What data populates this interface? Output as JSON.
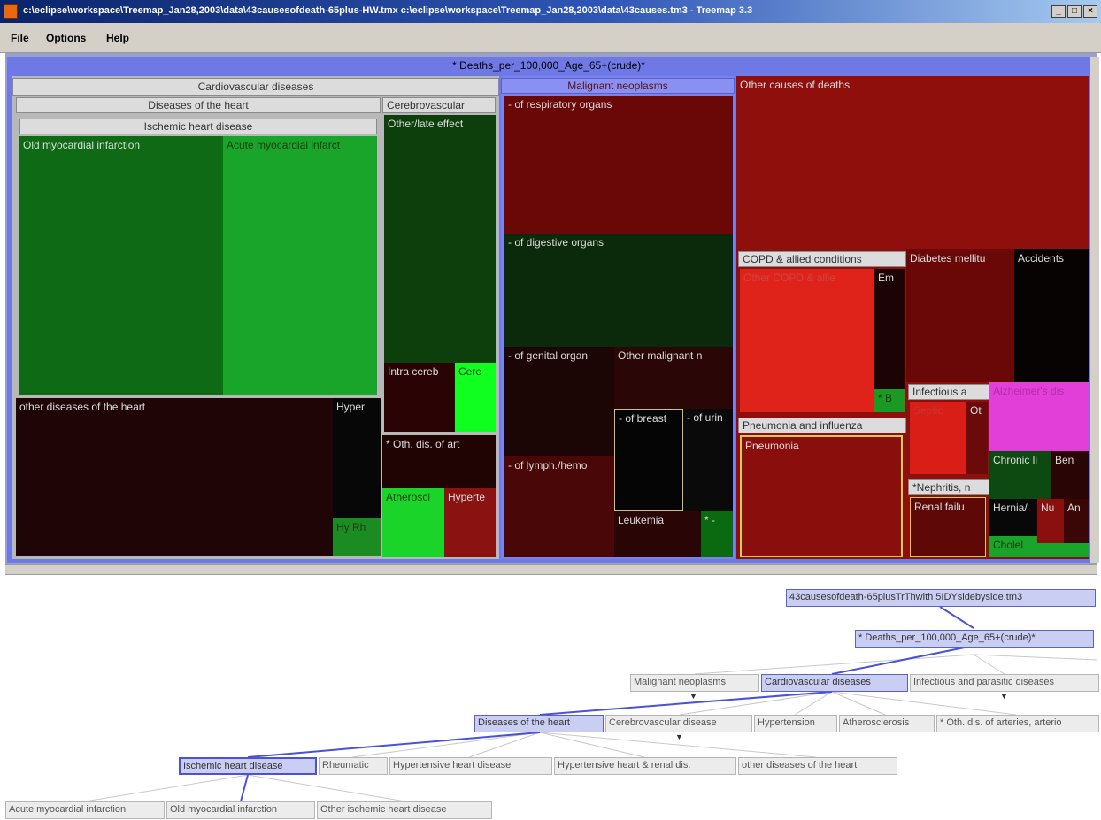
{
  "window": {
    "title": "c:\\eclipse\\workspace\\Treemap_Jan28,2003\\data\\43causesofdeath-65plus-HW.tmx c:\\eclipse\\workspace\\Treemap_Jan28,2003\\data\\43causes.tm3 - Treemap 3.3",
    "min_glyph": "_",
    "max_glyph": "□",
    "close_glyph": "×"
  },
  "menu": {
    "file": "File",
    "options": "Options",
    "help": "Help"
  },
  "treemap": {
    "root_label": "* Deaths_per_100,000_Age_65+(crude)*",
    "cardio": {
      "label": "Cardiovascular diseases",
      "heart": {
        "label": "Diseases of the heart",
        "ischemic": {
          "label": "Ischemic heart disease",
          "old_mi": "Old myocardial infarction",
          "acute_mi": "Acute myocardial infarct"
        },
        "other_heart": "other diseases of the heart",
        "hyper": "Hyper",
        "small": "Hy Rh"
      },
      "cerebro": {
        "label": "Cerebrovascular",
        "otherlate": "Other/late effect",
        "intracereb": "Intra cereb",
        "cere": "Cere"
      },
      "arteries": {
        "label": "* Oth. dis. of art",
        "athero": "Atheroscl",
        "hypert": "Hyperte"
      }
    },
    "malignant": {
      "label": "Malignant neoplasms",
      "respiratory": "- of respiratory organs",
      "digestive": "- of digestive organs",
      "genital": "- of genital organ",
      "other": "Other malignant n",
      "breast": "- of breast",
      "urinary": "- of urin",
      "lymph": "- of lymph./hemo",
      "leukemia": "Leukemia",
      "small": "* -"
    },
    "other_causes": {
      "label": "Other causes of deaths",
      "copd": {
        "label": "COPD & allied conditions",
        "other": "Other COPD & allie",
        "em": "Em",
        "small": "* B"
      },
      "diabetes": "Diabetes mellitu",
      "accidents": "Accidents",
      "infectious": {
        "label": "Infectious a",
        "septic": "Septic",
        "ot": "Ot"
      },
      "alzheimer": "Alzheimer's dis",
      "pneumonia": {
        "label": "Pneumonia and influenza",
        "pneumonia": "Pneumonia"
      },
      "chronic": "Chronic li",
      "ben": "Ben",
      "nephritis": {
        "label": "*Nephritis, n",
        "renal": "Renal failu"
      },
      "hernia": "Hernia/",
      "nu": "Nu",
      "an": "An",
      "cholel": "Cholel"
    }
  },
  "tree": {
    "file_node": "43causesofdeath-65plusTrThwith 5IDYsidebyside.tm3",
    "root_node": "* Deaths_per_100,000_Age_65+(crude)*",
    "level1": [
      "Malignant neoplasms",
      "Cardiovascular diseases",
      "Infectious and parasitic diseases"
    ],
    "level2": [
      "Diseases of the heart",
      "Cerebrovascular disease",
      "Hypertension",
      "Atherosclerosis",
      "* Oth. dis. of arteries, arterio"
    ],
    "level3": [
      "Ischemic heart disease",
      "Rheumatic",
      "Hypertensive heart disease",
      "Hypertensive heart & renal dis.",
      "other diseases of the heart"
    ],
    "level4": [
      "Acute myocardial infarction",
      "Old myocardial infarction",
      "Other ischemic heart disease"
    ],
    "down_arrow": "▼"
  },
  "colors": {
    "green_dark": "#0e6a14",
    "green_bright": "#19a42a",
    "red": "#8e0f0c",
    "bright_red": "#e0231a",
    "magenta": "#e23ed8",
    "selection": "#5a62c9"
  }
}
